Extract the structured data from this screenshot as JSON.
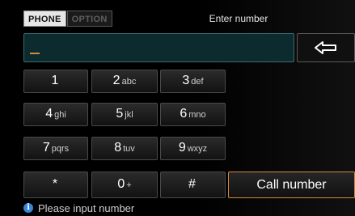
{
  "tabs": [
    {
      "label": "PHONE",
      "active": true
    },
    {
      "label": "OPTION",
      "active": false
    }
  ],
  "header": {
    "title": "Enter number"
  },
  "number_input": {
    "value": ""
  },
  "keypad": {
    "keys": [
      {
        "digit": "1",
        "letters": ""
      },
      {
        "digit": "2",
        "letters": "abc"
      },
      {
        "digit": "3",
        "letters": "def"
      },
      {
        "digit": "4",
        "letters": "ghi"
      },
      {
        "digit": "5",
        "letters": "jkl"
      },
      {
        "digit": "6",
        "letters": "mno"
      },
      {
        "digit": "7",
        "letters": "pqrs"
      },
      {
        "digit": "8",
        "letters": "tuv"
      },
      {
        "digit": "9",
        "letters": "wxyz"
      },
      {
        "digit": "*",
        "letters": ""
      },
      {
        "digit": "0",
        "letters": "+"
      },
      {
        "digit": "#",
        "letters": ""
      }
    ]
  },
  "call_button": {
    "label": "Call number"
  },
  "status": {
    "text": "Please input number",
    "icon": "info-icon"
  },
  "colors": {
    "accent": "#d08a3a",
    "input_bg": "#0c2b2e",
    "info": "#3a86d6"
  }
}
